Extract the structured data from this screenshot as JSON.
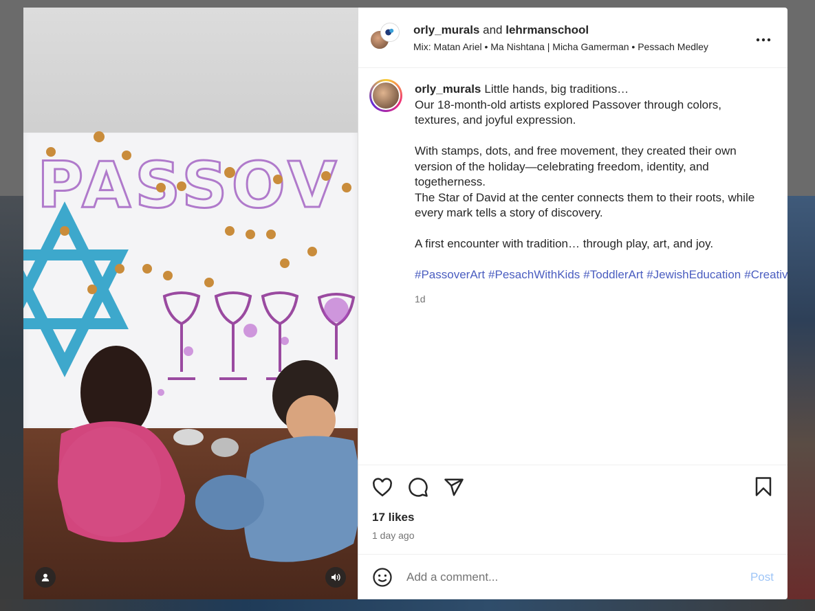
{
  "post": {
    "header": {
      "user1": "orly_murals",
      "joiner": "and",
      "user2": "lehrmanschool",
      "music": "Mix: Matan Ariel • Ma Nishtana | Micha Gamerman • Pessach Medley",
      "more_icon": "more-horizontal-icon"
    },
    "caption": {
      "username": "orly_murals",
      "lines": [
        "Little hands, big traditions…",
        "Our 18-month-old artists explored Passover through colors, textures, and joyful expression.",
        "",
        "With stamps, dots, and free movement, they created their own version of the holiday—celebrating freedom, identity, and togetherness.",
        "The Star of David at the center connects them to their roots, while every mark tells a story of discovery.",
        "",
        "A first encounter with tradition… through play, art, and joy."
      ],
      "hashtags": [
        "#PassoverArt",
        "#PesachWithKids",
        "#ToddlerArt",
        "#JewishEducation",
        "#CreativeKids"
      ],
      "time_ago": "1d"
    },
    "media": {
      "poster_text": "PASSOV",
      "icons": [
        "user-tag-icon",
        "audio-icon"
      ]
    },
    "actions": {
      "icons": [
        "heart-icon",
        "comment-icon",
        "share-icon",
        "bookmark-icon"
      ],
      "likes": "17 likes",
      "date": "1 day ago"
    },
    "comment": {
      "placeholder": "Add a comment...",
      "post_label": "Post",
      "emoji_icon": "emoji-icon"
    }
  },
  "colors": {
    "link": "#4a5dc0",
    "post_disabled": "#9ec5f7",
    "text": "#262626",
    "secondary": "#737373"
  }
}
